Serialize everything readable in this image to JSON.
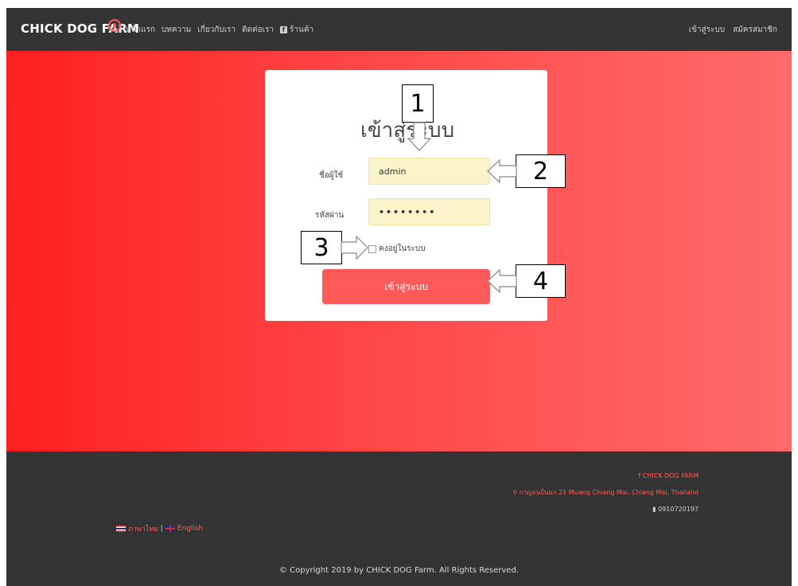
{
  "navbar": {
    "brand": "CHICK DOG FARM",
    "links": [
      "หน้าแรก",
      "บทความ",
      "เกี่ยวกับเรา",
      "ติดต่อเรา"
    ],
    "shop": "ร้านค้า",
    "right_links": [
      "เข้าสู่ระบบ",
      "สมัครสมาชิก"
    ]
  },
  "login": {
    "title": "เข้าสู่ระบบ",
    "username_label": "ชื่อผู้ใช้",
    "username_value": "admin",
    "password_label": "รหัสผ่าน",
    "password_value": "••••••••",
    "remember_label": "คงอยู่ในระบบ",
    "submit_label": "เข้าสู่ระบบ"
  },
  "annotations": [
    "1",
    "2",
    "3",
    "4"
  ],
  "footer": {
    "facebook": "CHICK DOG FARM",
    "address": "กาญจนบีนมก 21 Muang Chiang Mai, Chiang Mai, Thailand",
    "phone": "0910720197",
    "lang_th": "ภาษาไทย",
    "lang_sep": "|",
    "lang_en": "English",
    "copyright": "© Copyright 2019 by CHICK DOG Farm. All Rights Reserved."
  },
  "colors": {
    "navbar": "#333333",
    "hero_start": "#ff1f1f",
    "hero_end": "#ff6a6a",
    "button": "#ff5a5a",
    "input_fill": "#fbf3c9"
  },
  "icons": [
    "brand-logo-icon",
    "facebook-icon",
    "map-pin-icon",
    "phone-icon",
    "thai-flag-icon",
    "uk-flag-icon"
  ]
}
